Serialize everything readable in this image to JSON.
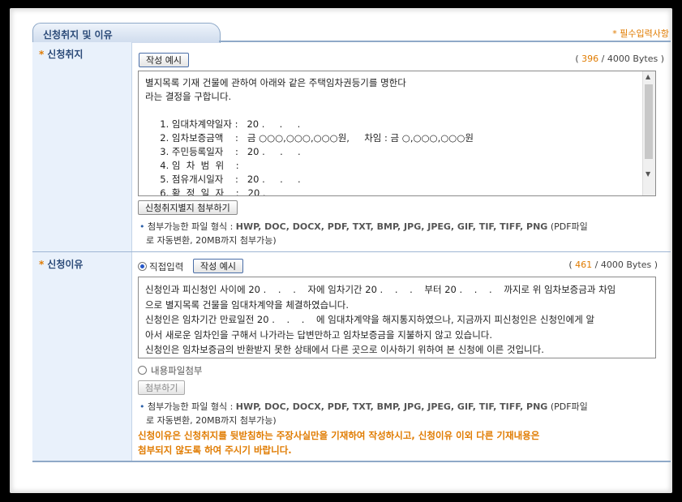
{
  "section": {
    "title": "신청취지 및 이유",
    "required_note": "* 필수입력사항"
  },
  "purpose": {
    "label": "신청취지",
    "example_button": "작성 예시",
    "counter_current": "396",
    "counter_total": "/ 4000 Bytes )",
    "counter_open": "(",
    "text": "별지목록 기재 건물에 관하여 아래와 같은 주택임차권등기를 명한다\n라는 결정을 구합니다.\n\n     1. 임대차계약일자 :   20 .     .     .\n     2. 임차보증금액    :   금 ○○○,○○○,○○○원,     차임 : 금 ○,○○○,○○○원\n     3. 주민등록일자    :   20 .     .     .\n     4. 임  차  범  위    :\n     5. 점유개시일자    :   20 .     .     .\n     6. 확  정  일  자    :   20 .",
    "attach_button": "신청취지별지 첨부하기",
    "info_line1_prefix": "첨부가능한 파일 형식 : ",
    "info_formats": "HWP, DOC, DOCX, PDF, TXT, BMP, JPG, JPEG, GIF, TIF, TIFF, PNG",
    "info_line1_suffix": " (PDF파일",
    "info_line2": "로 자동변환, 20MB까지 첨부가능)"
  },
  "reason": {
    "label": "신청이유",
    "radio_direct": "직접입력",
    "example_button": "작성 예시",
    "counter_open": "(",
    "counter_current": "461",
    "counter_total": "/ 4000 Bytes )",
    "text": "신청인과 피신청인 사이에 20 .    .    .    자에 임차기간 20 .    .    .    부터 20 .    .    .    까지로 위 임차보증금과 차임\n으로 별지목록 건물을 임대차계약을 체결하였습니다.\n신청인은 임차기간 만료일전 20 .    .    .    에 임대차계약을 해지통지하였으나, 지금까지 피신청인은 신청인에게 알\n아서 새로운 임차인을 구해서 나가라는 답변만하고 임차보증금을 지불하지 않고 있습니다.\n신청인은 임차보증금의 반환받지 못한 상태에서 다른 곳으로 이사하기 위하여 본 신청에 이른 것입니다.",
    "radio_file": "내용파일첨부",
    "attach_button": "첨부하기",
    "info_line1_prefix": "첨부가능한 파일 형식 : ",
    "info_formats": "HWP, DOC, DOCX, PDF, TXT, BMP, JPG, JPEG, GIF, TIF, TIFF, PNG",
    "info_line1_suffix": " (PDF파일",
    "info_line2": "로 자동변환, 20MB까지 첨부가능)",
    "warning_line1": "신청이유은 신청취지를 뒷받침하는 주장사실만을 기재하여 작성하시고, 신청이유 이외 다른 기재내용은",
    "warning_line2": "첨부되지 않도록 하여 주시기 바랍니다."
  },
  "colors": {
    "accent_orange": "#e07b00",
    "header_blue": "#2b4a78",
    "label_bg": "#e9f1fb"
  }
}
